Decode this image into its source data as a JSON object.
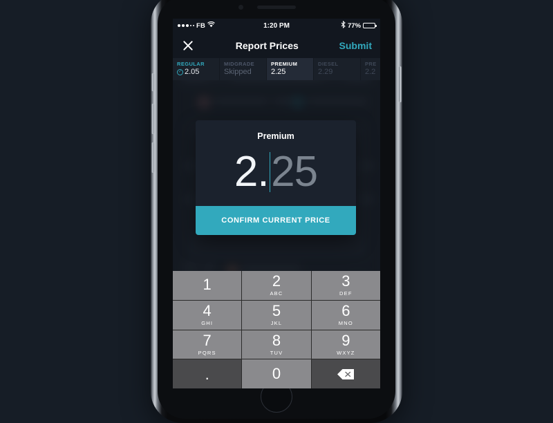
{
  "status_bar": {
    "carrier": "FB",
    "signal_filled": 3,
    "signal_empty": 2,
    "wifi_icon": "wifi-icon",
    "time": "1:20 PM",
    "bluetooth_icon": "bluetooth-icon",
    "battery_percent": "77%",
    "battery_level": 77
  },
  "nav": {
    "close_icon": "close-icon",
    "title": "Report Prices",
    "submit_label": "Submit"
  },
  "fuel_tabs": [
    {
      "label": "REGULAR",
      "value": "2.05",
      "state": "done",
      "has_check": true
    },
    {
      "label": "MIDGRADE",
      "value": "Skipped",
      "state": "skipped",
      "has_check": false
    },
    {
      "label": "PREMIUM",
      "value": "2.25",
      "state": "active",
      "has_check": false
    },
    {
      "label": "DIESEL",
      "value": "2.29",
      "state": "pending",
      "has_check": false
    },
    {
      "label": "PRE",
      "value": "2.2",
      "state": "pending",
      "has_check": false
    }
  ],
  "price_card": {
    "title": "Premium",
    "entered": "2.",
    "placeholder": "25",
    "confirm_label": "CONFIRM CURRENT PRICE"
  },
  "keypad": [
    {
      "digit": "1",
      "letters": "",
      "style": "light"
    },
    {
      "digit": "2",
      "letters": "ABC",
      "style": "light"
    },
    {
      "digit": "3",
      "letters": "DEF",
      "style": "light"
    },
    {
      "digit": "4",
      "letters": "GHI",
      "style": "light"
    },
    {
      "digit": "5",
      "letters": "JKL",
      "style": "light"
    },
    {
      "digit": "6",
      "letters": "MNO",
      "style": "light"
    },
    {
      "digit": "7",
      "letters": "PQRS",
      "style": "light"
    },
    {
      "digit": "8",
      "letters": "TUV",
      "style": "light"
    },
    {
      "digit": "9",
      "letters": "WXYZ",
      "style": "light"
    },
    {
      "digit": ".",
      "letters": "",
      "style": "dark"
    },
    {
      "digit": "0",
      "letters": "",
      "style": "light"
    },
    {
      "digit": "",
      "letters": "",
      "style": "dark",
      "icon": "backspace-icon"
    }
  ],
  "colors": {
    "accent_teal": "#32a9bd",
    "screen_bg": "#1c222c",
    "card_bg": "#1b222d",
    "navbar_bg": "#12171f",
    "keypad_light": "#8a8a8d",
    "keypad_dark": "#4a4a4c",
    "page_bg": "#161d26"
  }
}
